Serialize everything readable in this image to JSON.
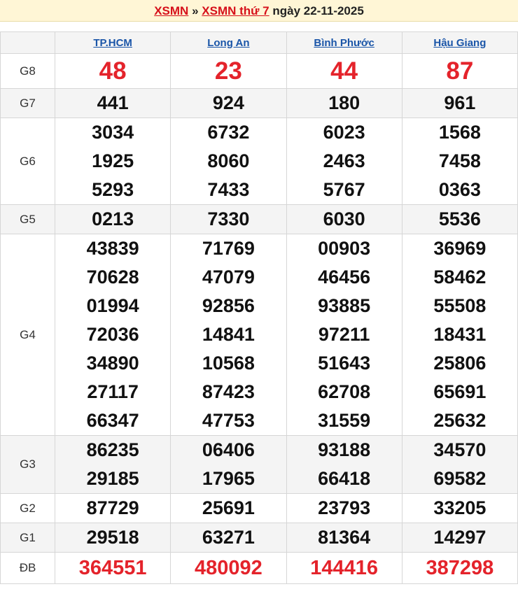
{
  "header": {
    "link1": "XSMN",
    "sep": "»",
    "link2": "XSMN thứ 7",
    "date_text": "ngày 22-11-2025"
  },
  "provinces": [
    "TP.HCM",
    "Long An",
    "Bình Phước",
    "Hậu Giang"
  ],
  "prizes": [
    {
      "label": "G8",
      "values": [
        [
          "48"
        ],
        [
          "23"
        ],
        [
          "44"
        ],
        [
          "87"
        ]
      ]
    },
    {
      "label": "G7",
      "values": [
        [
          "441"
        ],
        [
          "924"
        ],
        [
          "180"
        ],
        [
          "961"
        ]
      ]
    },
    {
      "label": "G6",
      "values": [
        [
          "3034",
          "1925",
          "5293"
        ],
        [
          "6732",
          "8060",
          "7433"
        ],
        [
          "6023",
          "2463",
          "5767"
        ],
        [
          "1568",
          "7458",
          "0363"
        ]
      ]
    },
    {
      "label": "G5",
      "values": [
        [
          "0213"
        ],
        [
          "7330"
        ],
        [
          "6030"
        ],
        [
          "5536"
        ]
      ]
    },
    {
      "label": "G4",
      "values": [
        [
          "43839",
          "70628",
          "01994",
          "72036",
          "34890",
          "27117",
          "66347"
        ],
        [
          "71769",
          "47079",
          "92856",
          "14841",
          "10568",
          "87423",
          "47753"
        ],
        [
          "00903",
          "46456",
          "93885",
          "97211",
          "51643",
          "62708",
          "31559"
        ],
        [
          "36969",
          "58462",
          "55508",
          "18431",
          "25806",
          "65691",
          "25632"
        ]
      ]
    },
    {
      "label": "G3",
      "values": [
        [
          "86235",
          "29185"
        ],
        [
          "06406",
          "17965"
        ],
        [
          "93188",
          "66418"
        ],
        [
          "34570",
          "69582"
        ]
      ]
    },
    {
      "label": "G2",
      "values": [
        [
          "87729"
        ],
        [
          "25691"
        ],
        [
          "23793"
        ],
        [
          "33205"
        ]
      ]
    },
    {
      "label": "G1",
      "values": [
        [
          "29518"
        ],
        [
          "63271"
        ],
        [
          "81364"
        ],
        [
          "14297"
        ]
      ]
    },
    {
      "label": "ĐB",
      "values": [
        [
          "364551"
        ],
        [
          "480092"
        ],
        [
          "144416"
        ],
        [
          "387298"
        ]
      ]
    }
  ]
}
